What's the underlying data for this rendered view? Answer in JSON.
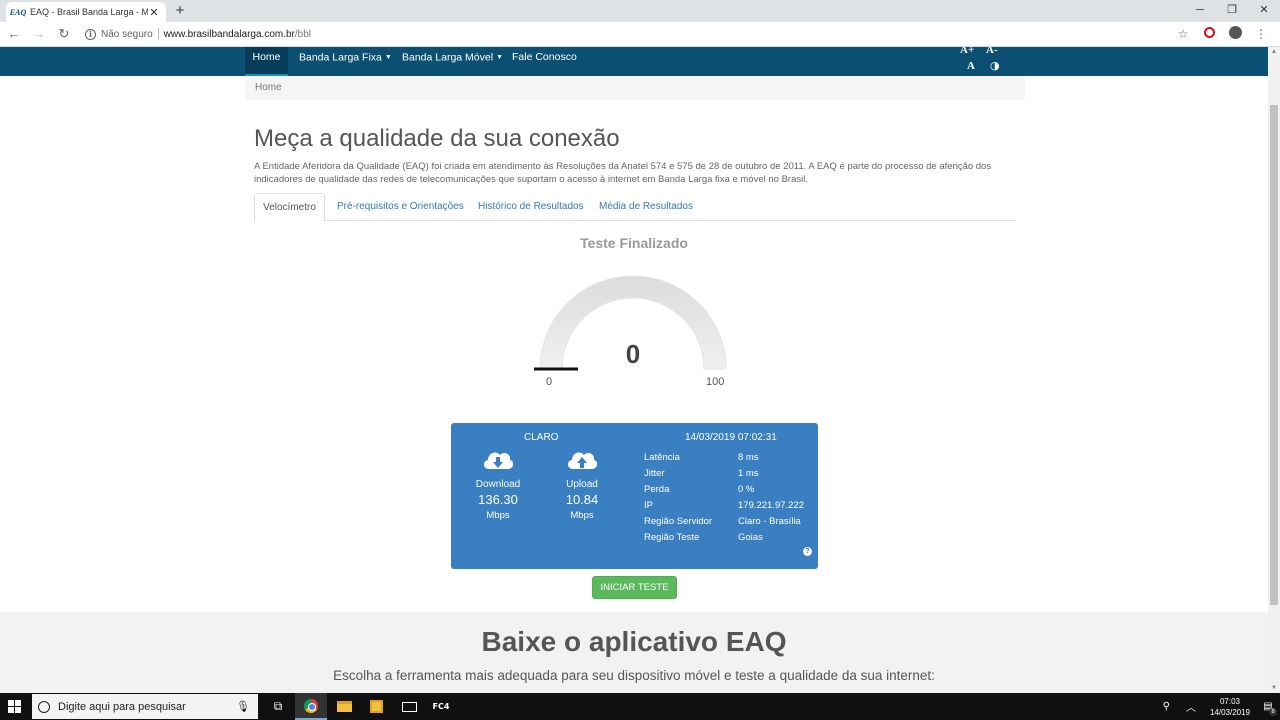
{
  "browser": {
    "favicon_label": "EAQ",
    "tab_title": "EAQ - Brasil Banda Larga - Meça",
    "new_tab": "+",
    "security_label": "Não seguro",
    "url_host": "www.brasilbandalarga.com.br",
    "url_path": "/bbl",
    "back": "←",
    "forward": "→",
    "reload": "↻",
    "bookmark_icon": "☆",
    "menu_icon": "⋮",
    "minimize": "─",
    "restore": "❐",
    "close": "✕"
  },
  "nav": {
    "items": [
      {
        "label": "Home"
      },
      {
        "label": "Banda Larga Fixa"
      },
      {
        "label": "Banda Larga Móvel"
      },
      {
        "label": "Fale Conosco"
      }
    ],
    "font_increase": "A+",
    "font_decrease": "A-",
    "font_reset": "A",
    "contrast": "◑"
  },
  "breadcrumb": {
    "current": "Home"
  },
  "page": {
    "title": "Meça a qualidade da sua conexão",
    "intro": "A Entidade Aferidora da Qualidade (EAQ) foi criada em atendimento às Resoluções da Anatel 574 e 575 de 28 de outubro de 2011. A EAQ é parte do processo de aferição dos indicadores de qualidade das redes de telecomunicações que suportam o acesso à internet em Banda Larga fixa e móvel no Brasil."
  },
  "tabs": [
    {
      "label": "Velocímetro",
      "active": true
    },
    {
      "label": "Pré-requisitos e Orientações"
    },
    {
      "label": "Histórico de Resultados"
    },
    {
      "label": "Média de Resultados"
    }
  ],
  "test": {
    "status": "Teste Finalizado",
    "gauge": {
      "value": "0",
      "min": "0",
      "max": "100"
    }
  },
  "result": {
    "provider": "CLARO",
    "datetime": "14/03/2019 07:02:31",
    "download": {
      "label": "Download",
      "value": "136.30",
      "unit": "Mbps"
    },
    "upload": {
      "label": "Upload",
      "value": "10.84",
      "unit": "Mbps"
    },
    "metrics": [
      {
        "key": "Latência",
        "value": "8 ms"
      },
      {
        "key": "Jitter",
        "value": "1 ms"
      },
      {
        "key": "Perda",
        "value": "0 %"
      },
      {
        "key": "IP",
        "value": "179.221.97.222"
      },
      {
        "key": "Região Servidor",
        "value": "Claro - Brasília"
      },
      {
        "key": "Região Teste",
        "value": "Goias"
      }
    ],
    "help_icon": "?"
  },
  "start_button": "INICIAR TESTE",
  "app": {
    "title": "Baixe o aplicativo EAQ",
    "subtitle": "Escolha a ferramenta mais adequada para seu dispositivo móvel e teste a qualidade da sua internet:"
  },
  "taskbar": {
    "search_placeholder": "Digite aqui para pesquisar",
    "fc_label": "FC4",
    "clock_time": "07:03",
    "clock_date": "14/03/2019",
    "notification_count": "8"
  },
  "colors": {
    "nav_bg": "#0b4f72",
    "panel_bg": "#3a7fc1",
    "button_green": "#5cb85c",
    "link_blue": "#337ab7"
  }
}
